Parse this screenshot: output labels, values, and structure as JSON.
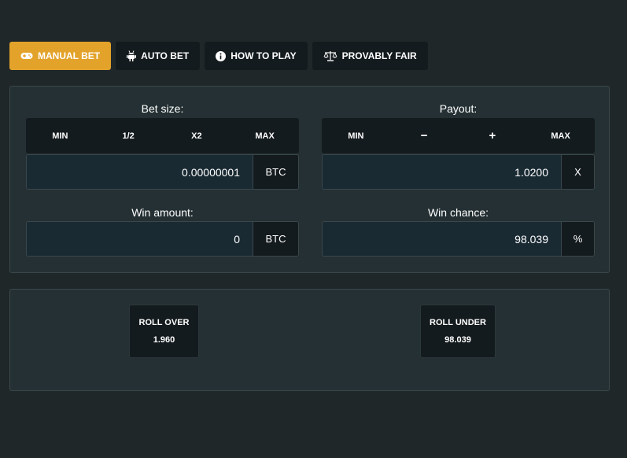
{
  "tabs": [
    {
      "label": "MANUAL BET",
      "icon": "gamepad-icon",
      "active": true
    },
    {
      "label": "AUTO BET",
      "icon": "robot-icon",
      "active": false
    },
    {
      "label": "HOW TO PLAY",
      "icon": "info-icon",
      "active": false
    },
    {
      "label": "PROVABLY FAIR",
      "icon": "scales-icon",
      "active": false
    }
  ],
  "bet_size": {
    "label": "Bet size:",
    "buttons": [
      "MIN",
      "1/2",
      "X2",
      "MAX"
    ],
    "value": "0.00000001",
    "unit": "BTC"
  },
  "payout": {
    "label": "Payout:",
    "buttons": [
      "MIN",
      "−",
      "+",
      "MAX"
    ],
    "value": "1.0200",
    "unit": "X"
  },
  "win_amount": {
    "label": "Win amount:",
    "value": "0",
    "unit": "BTC"
  },
  "win_chance": {
    "label": "Win chance:",
    "value": "98.039",
    "unit": "%"
  },
  "roll_over": {
    "label": "ROLL OVER",
    "value": "1.960"
  },
  "roll_under": {
    "label": "ROLL UNDER",
    "value": "98.039"
  },
  "colors": {
    "accent": "#e3a22a",
    "background": "#1f2729",
    "panel": "#243033",
    "dark_button": "#141b1e",
    "input": "#1a2a33"
  }
}
